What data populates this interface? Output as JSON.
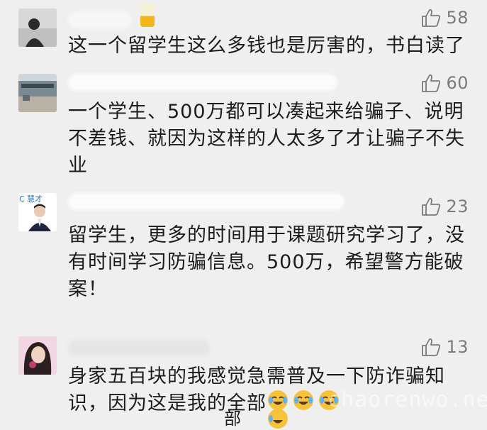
{
  "comments": [
    {
      "likes": "58",
      "text": "这一个留学生这么多钱也是厉害的，书白读了"
    },
    {
      "likes": "60",
      "text": "一个学生、500万都可以凑起来给骗子、说明不差钱、就因为这样的人太多了才让骗子不失业"
    },
    {
      "likes": "23",
      "text": "留学生，更多的时间用于课题研究学习了，没有时间学习防骗信息。500万，希望警方能破案！"
    },
    {
      "likes": "13",
      "text": "身家五百块的我感觉急需普及一下防诈骗知识，因为这是我的全部"
    }
  ],
  "avatar3_badge": "C 慧才",
  "overlay_text": "部",
  "watermark": "chaorenwo.net",
  "colors": {
    "background": "#efefef",
    "text": "#1c1c1c",
    "like": "#7b7b7b"
  },
  "icons": [
    "thumbs-up-icon",
    "crying-laughing-emoji"
  ]
}
